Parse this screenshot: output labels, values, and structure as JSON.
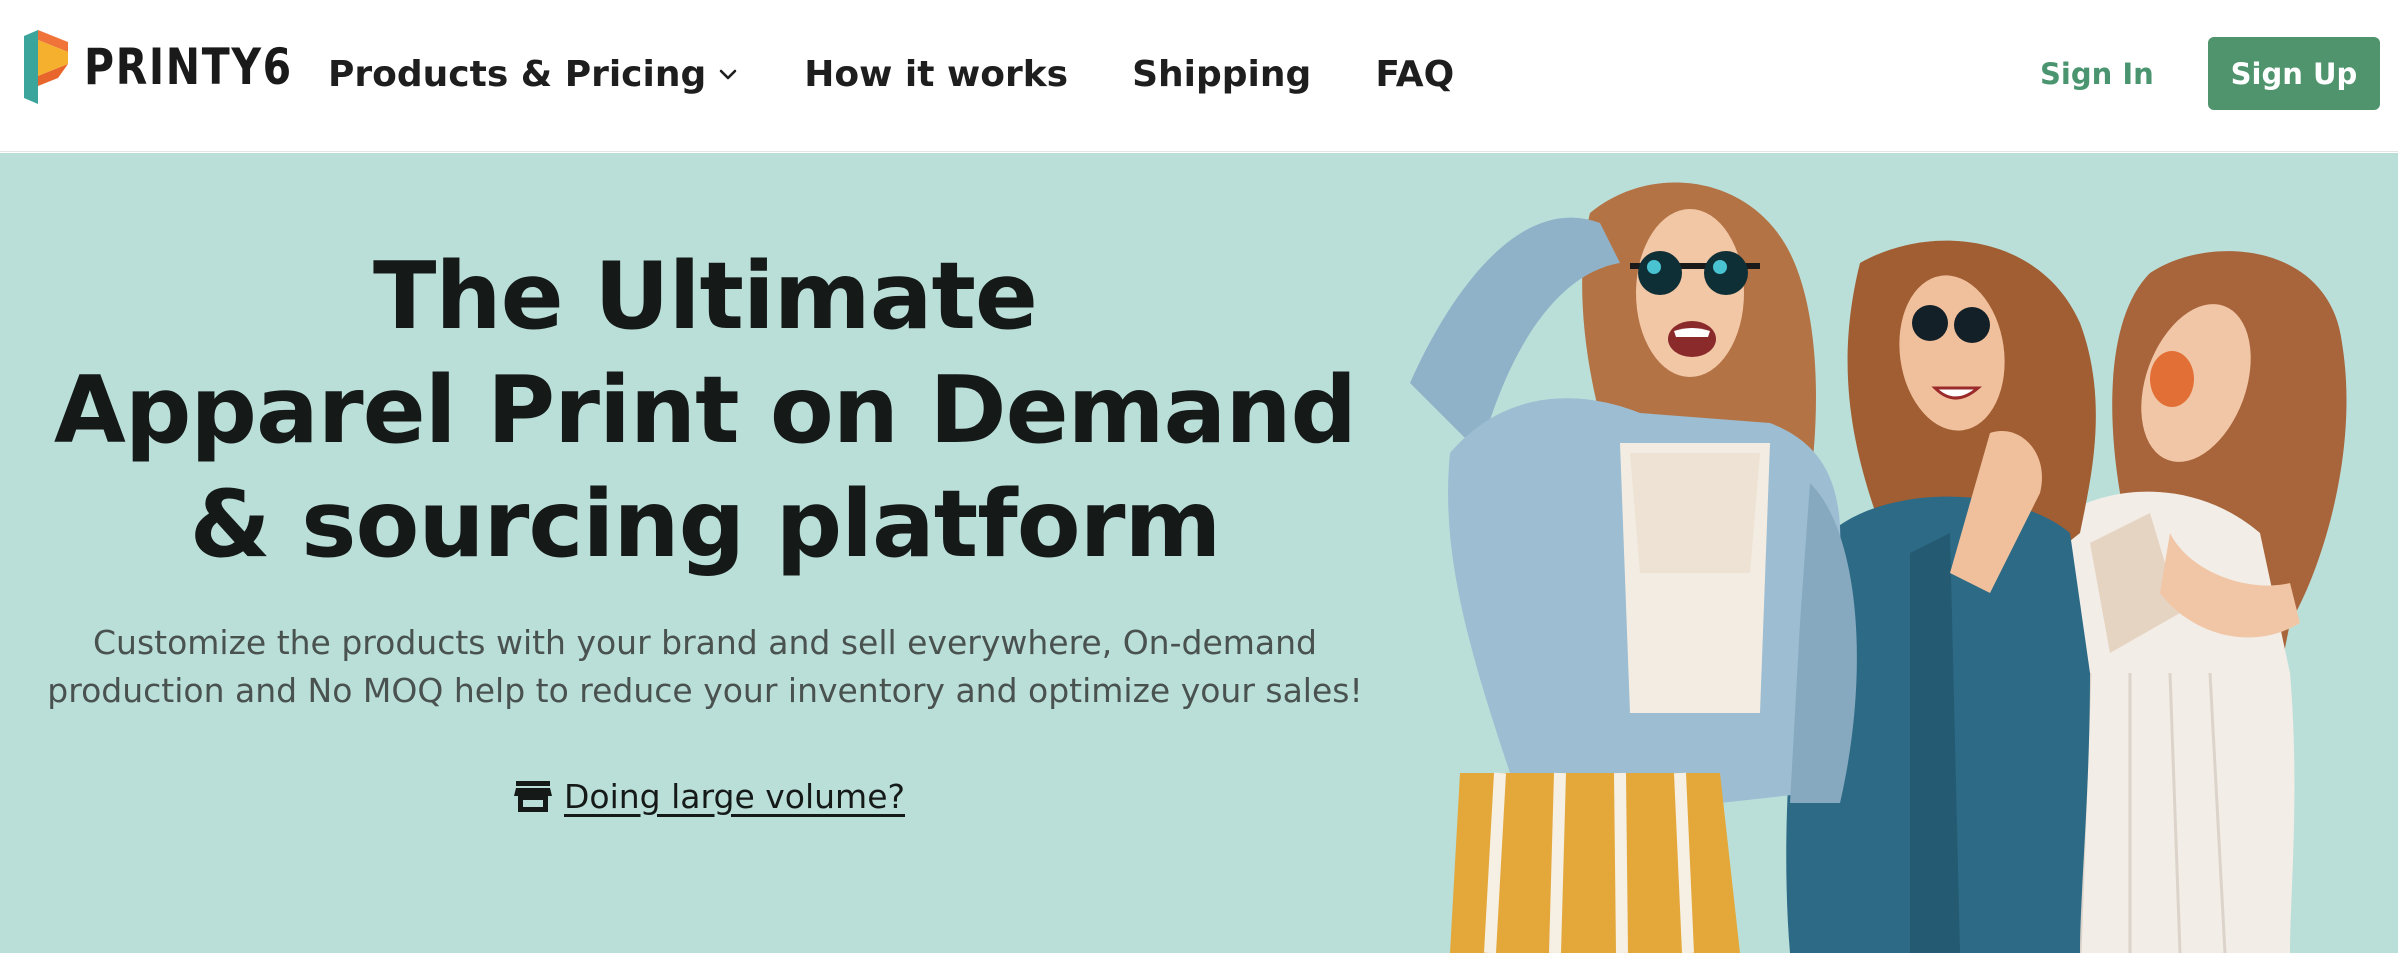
{
  "brand": {
    "name": "PRINTY6"
  },
  "nav": {
    "items": [
      {
        "label": "Products & Pricing",
        "has_dropdown": true
      },
      {
        "label": "How it works",
        "has_dropdown": false
      },
      {
        "label": "Shipping",
        "has_dropdown": false
      },
      {
        "label": "FAQ",
        "has_dropdown": false
      }
    ],
    "signin_label": "Sign In",
    "signup_label": "Sign Up"
  },
  "hero": {
    "headline_lines": [
      "The Ultimate",
      "Apparel Print on Demand",
      "& sourcing platform"
    ],
    "subtext_lines": [
      "Customize the products with your brand and sell everywhere, On-demand",
      "production and No MOQ help to reduce your inventory and optimize your sales!"
    ],
    "volume_link_label": "Doing large volume?",
    "volume_icon": "storefront-icon",
    "photo_icon": "hero-photo"
  },
  "colors": {
    "hero_bg": "#badfd9",
    "accent_green": "#4f946d",
    "signin_green": "#4a9570",
    "text_dark": "#151a18",
    "logo_orange": "#f0743a",
    "logo_yellow": "#f5b12e",
    "logo_teal": "#3ba59b"
  }
}
